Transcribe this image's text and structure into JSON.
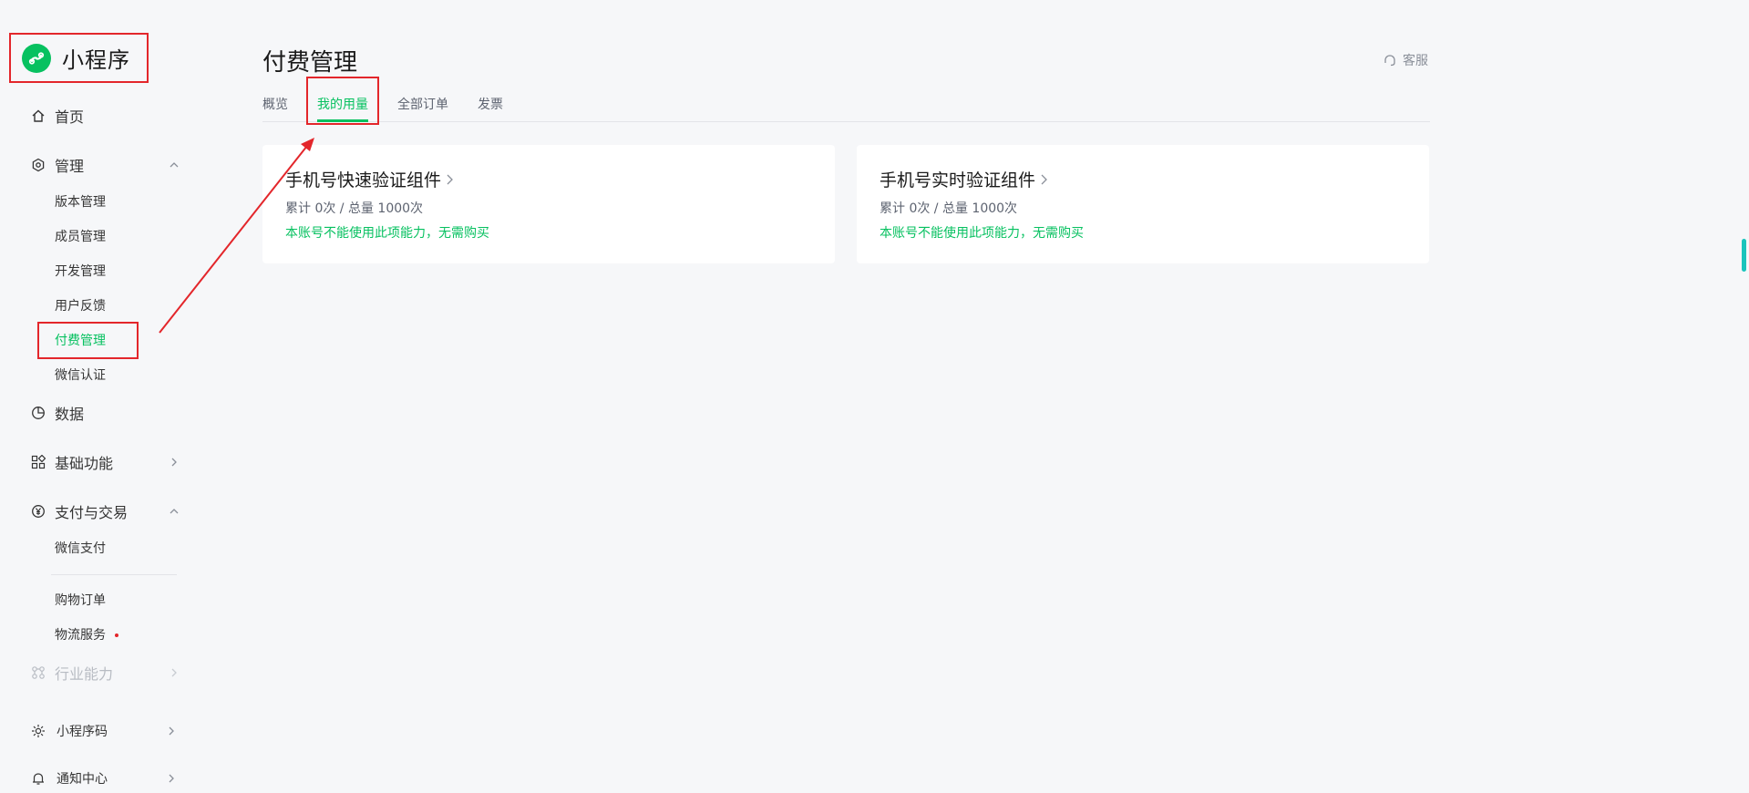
{
  "app": {
    "logo_text": "小程序"
  },
  "sidebar": {
    "home": "首页",
    "manage": {
      "label": "管理",
      "items": [
        "版本管理",
        "成员管理",
        "开发管理",
        "用户反馈",
        "付费管理",
        "微信认证"
      ]
    },
    "data": "数据",
    "basic": "基础功能",
    "pay": {
      "label": "支付与交易",
      "items": [
        "微信支付",
        "购物订单",
        "物流服务"
      ]
    },
    "industry": "行业能力",
    "qrcode": "小程序码",
    "notify": "通知中心"
  },
  "header": {
    "title": "付费管理",
    "service_label": "客服"
  },
  "tabs": [
    "概览",
    "我的用量",
    "全部订单",
    "发票"
  ],
  "cards": [
    {
      "title": "手机号快速验证组件",
      "usage": "累计 0次 / 总量 1000次",
      "note": "本账号不能使用此项能力，无需购买"
    },
    {
      "title": "手机号实时验证组件",
      "usage": "累计 0次 / 总量 1000次",
      "note": "本账号不能使用此项能力，无需购买"
    }
  ],
  "colors": {
    "accent": "#07c160",
    "annotation": "#e3262b",
    "scroll": "#1ac4bc"
  }
}
